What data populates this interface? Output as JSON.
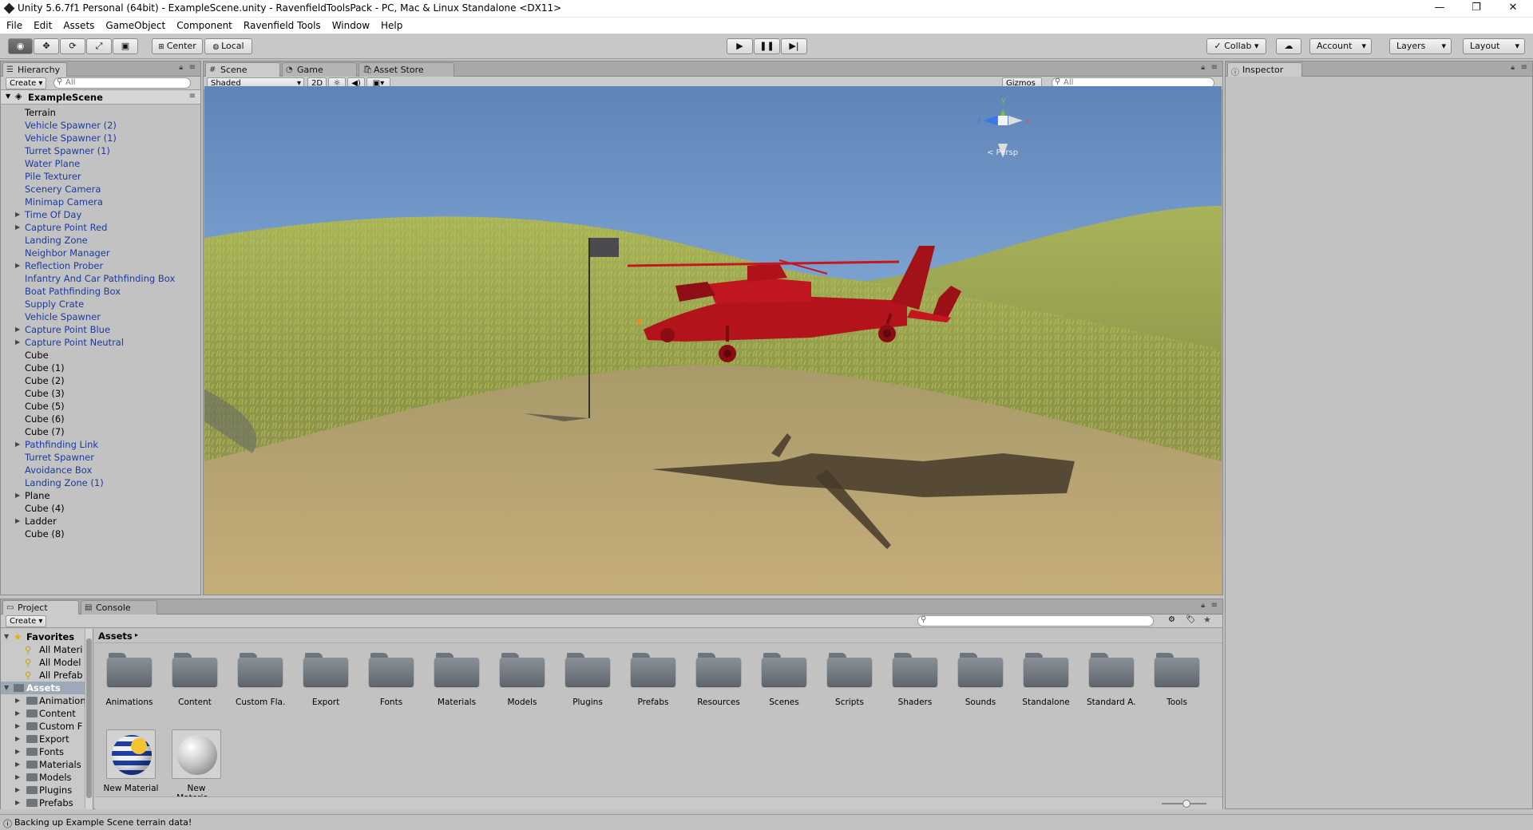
{
  "window": {
    "title": "Unity 5.6.7f1 Personal (64bit) - ExampleScene.unity - RavenfieldToolsPack - PC, Mac & Linux Standalone <DX11>",
    "minimize": "—",
    "maximize": "❐",
    "close": "✕"
  },
  "menu": [
    "File",
    "Edit",
    "Assets",
    "GameObject",
    "Component",
    "Ravenfield Tools",
    "Window",
    "Help"
  ],
  "toolbar": {
    "center": "Center",
    "local": "Local",
    "collab": "Collab ▾",
    "account": "Account",
    "layers": "Layers",
    "layout": "Layout"
  },
  "hierarchy": {
    "tab": "Hierarchy",
    "create": "Create ▾",
    "search_placeholder": "All",
    "scene": "ExampleScene",
    "items": [
      {
        "label": "Terrain",
        "prefab": false,
        "expand": false
      },
      {
        "label": "Vehicle Spawner (2)",
        "prefab": true,
        "expand": false
      },
      {
        "label": "Vehicle Spawner (1)",
        "prefab": true,
        "expand": false
      },
      {
        "label": "Turret Spawner (1)",
        "prefab": true,
        "expand": false
      },
      {
        "label": "Water Plane",
        "prefab": true,
        "expand": false
      },
      {
        "label": "Pile Texturer",
        "prefab": true,
        "expand": false
      },
      {
        "label": "Scenery Camera",
        "prefab": true,
        "expand": false
      },
      {
        "label": "Minimap Camera",
        "prefab": true,
        "expand": false
      },
      {
        "label": "Time Of Day",
        "prefab": true,
        "expand": true
      },
      {
        "label": "Capture Point Red",
        "prefab": true,
        "expand": true
      },
      {
        "label": "Landing Zone",
        "prefab": true,
        "expand": false
      },
      {
        "label": "Neighbor Manager",
        "prefab": true,
        "expand": false
      },
      {
        "label": "Reflection Prober",
        "prefab": true,
        "expand": true
      },
      {
        "label": "Infantry And Car Pathfinding Box",
        "prefab": true,
        "expand": false
      },
      {
        "label": "Boat Pathfinding Box",
        "prefab": true,
        "expand": false
      },
      {
        "label": "Supply Crate",
        "prefab": true,
        "expand": false
      },
      {
        "label": "Vehicle Spawner",
        "prefab": true,
        "expand": false
      },
      {
        "label": "Capture Point Blue",
        "prefab": true,
        "expand": true
      },
      {
        "label": "Capture Point Neutral",
        "prefab": true,
        "expand": true
      },
      {
        "label": "Cube",
        "prefab": false,
        "expand": false
      },
      {
        "label": "Cube (1)",
        "prefab": false,
        "expand": false
      },
      {
        "label": "Cube (2)",
        "prefab": false,
        "expand": false
      },
      {
        "label": "Cube (3)",
        "prefab": false,
        "expand": false
      },
      {
        "label": "Cube (5)",
        "prefab": false,
        "expand": false
      },
      {
        "label": "Cube (6)",
        "prefab": false,
        "expand": false
      },
      {
        "label": "Cube (7)",
        "prefab": false,
        "expand": false
      },
      {
        "label": "Pathfinding Link",
        "prefab": true,
        "expand": true
      },
      {
        "label": "Turret Spawner",
        "prefab": true,
        "expand": false
      },
      {
        "label": "Avoidance Box",
        "prefab": true,
        "expand": false
      },
      {
        "label": "Landing Zone (1)",
        "prefab": true,
        "expand": false
      },
      {
        "label": "Plane",
        "prefab": false,
        "expand": true
      },
      {
        "label": "Cube (4)",
        "prefab": false,
        "expand": false
      },
      {
        "label": "Ladder",
        "prefab": false,
        "expand": true
      },
      {
        "label": "Cube (8)",
        "prefab": false,
        "expand": false
      }
    ]
  },
  "scene": {
    "tabs": [
      "Scene",
      "Game",
      "Asset Store"
    ],
    "shading": "Shaded",
    "mode_2d": "2D",
    "gizmos": "Gizmos ▾",
    "search_placeholder": "All",
    "gizmo_labels": {
      "y": "y",
      "x": "x",
      "z": "z",
      "persp": "< Persp"
    }
  },
  "inspector": {
    "tab": "Inspector"
  },
  "project": {
    "tabs": [
      "Project",
      "Console"
    ],
    "create": "Create ▾",
    "favorites": {
      "title": "Favorites",
      "items": [
        "All Materi",
        "All Model",
        "All Prefab"
      ]
    },
    "assets_tree": {
      "title": "Assets",
      "items": [
        "Animation",
        "Content",
        "Custom F",
        "Export",
        "Fonts",
        "Materials",
        "Models",
        "Plugins",
        "Prefabs"
      ]
    },
    "breadcrumb": "Assets",
    "folders": [
      "Animations",
      "Content",
      "Custom Fla...",
      "Export",
      "Fonts",
      "Materials",
      "Models",
      "Plugins",
      "Prefabs",
      "Resources",
      "Scenes",
      "Scripts",
      "Shaders",
      "Sounds",
      "Standalone",
      "Standard A...",
      "Tools"
    ],
    "materials": [
      "New Material",
      "New Materia..."
    ]
  },
  "status": {
    "message": "Backing up Example Scene terrain data!"
  }
}
